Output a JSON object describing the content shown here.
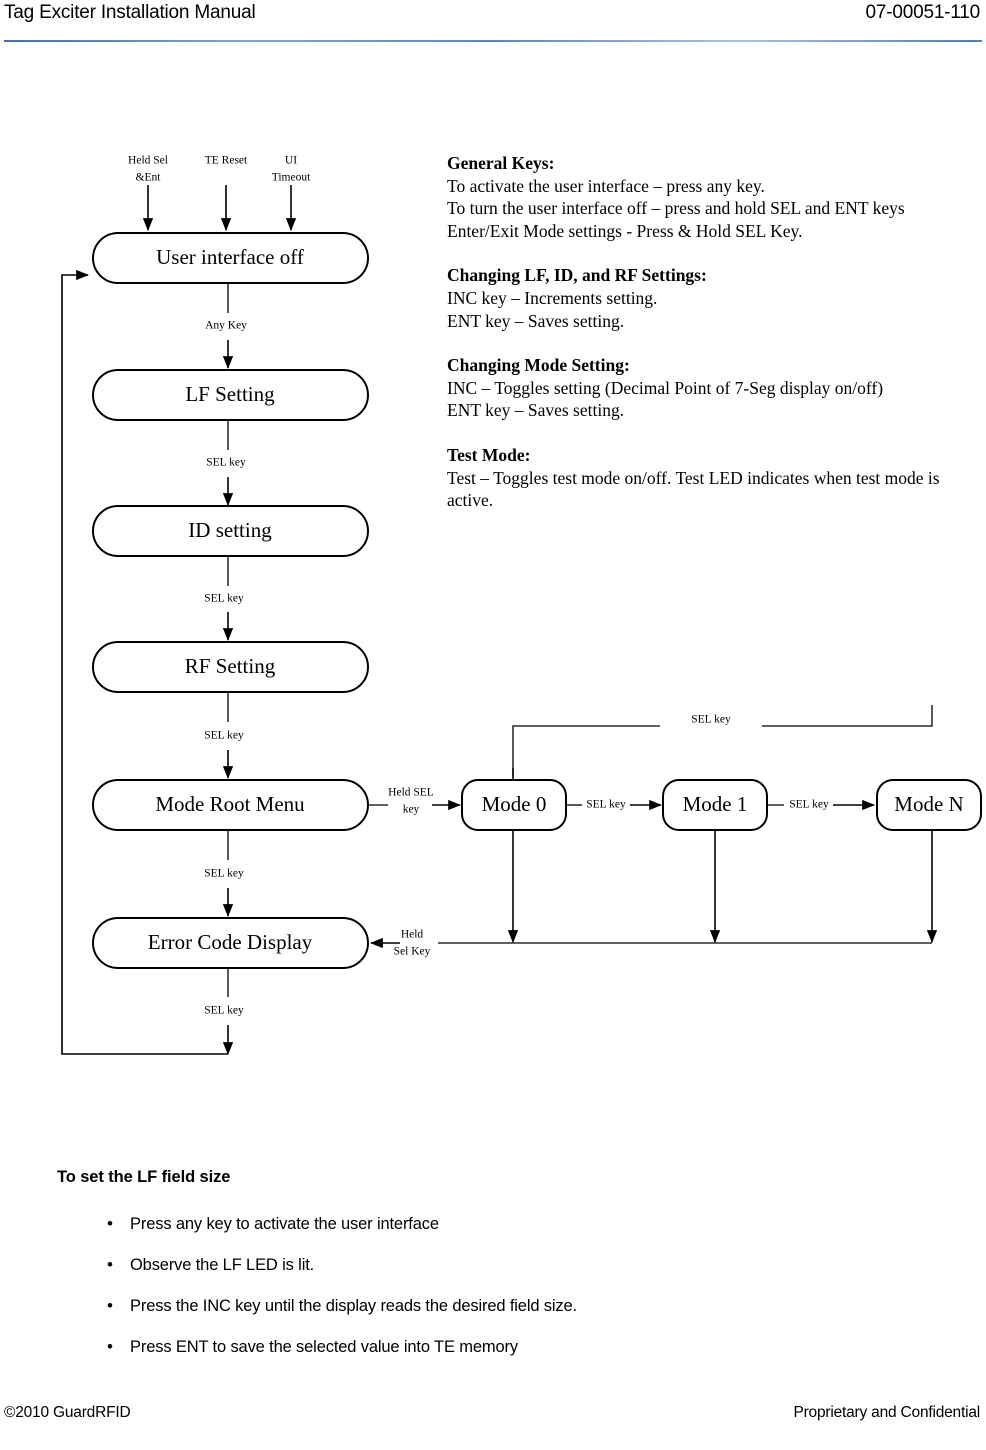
{
  "header": {
    "title": "Tag Exciter Installation Manual",
    "doc_number": "07-00051-110"
  },
  "diagram": {
    "inputs": [
      {
        "label_line1": "Held Sel",
        "label_line2": "&Ent"
      },
      {
        "label_line1": "TE Reset",
        "label_line2": ""
      },
      {
        "label_line1": "UI",
        "label_line2": "Timeout"
      }
    ],
    "main_nodes": [
      {
        "label": "User interface off"
      },
      {
        "label": "LF Setting"
      },
      {
        "label": "ID setting"
      },
      {
        "label": "RF Setting"
      },
      {
        "label": "Mode Root Menu"
      },
      {
        "label": "Error Code Display"
      }
    ],
    "main_edges": [
      {
        "label": "Any Key"
      },
      {
        "label": "SEL key"
      },
      {
        "label": "SEL key"
      },
      {
        "label": "SEL key"
      },
      {
        "label": "SEL key"
      },
      {
        "label": "SEL key"
      }
    ],
    "mode_nodes": [
      {
        "label": "Mode 0"
      },
      {
        "label": "Mode 1"
      },
      {
        "label": "Mode N"
      }
    ],
    "mode_edges": {
      "enter": "Held SEL\nkey",
      "enter_line1": "Held SEL",
      "enter_line2": "key",
      "between_0_1": "SEL key",
      "between_1_n": "SEL key",
      "feedback_top": "SEL key",
      "exit_line1": "Held",
      "exit_line2": "Sel Key"
    }
  },
  "notes": {
    "blocks": [
      {
        "heading": "General Keys:",
        "lines": [
          "To activate the user interface – press any key.",
          "To turn the user interface off – press and hold SEL and ENT keys",
          "Enter/Exit Mode settings - Press & Hold SEL Key."
        ]
      },
      {
        "heading": "Changing LF, ID, and RF Settings:",
        "lines": [
          "INC key – Increments setting.",
          "ENT key – Saves setting."
        ]
      },
      {
        "heading": "Changing Mode Setting:",
        "lines": [
          "INC – Toggles setting (Decimal Point of 7-Seg display on/off)",
          "ENT  key – Saves setting."
        ]
      },
      {
        "heading": "Test Mode:",
        "lines": [
          "Test – Toggles test mode on/off. Test LED indicates when test mode is active."
        ]
      }
    ]
  },
  "lf_section": {
    "heading": "To set the LF field size",
    "bullets": [
      "Press any key to activate the user interface",
      "Observe the LF LED is lit.",
      "Press the INC key until the display reads the desired field size.",
      "Press ENT to save the selected value into TE memory"
    ]
  },
  "footer": {
    "left": "©2010 GuardRFID",
    "right": "Proprietary and Confidential"
  },
  "colors": {
    "rule_accent": "#4472a8",
    "ink": "#000000",
    "page": "#ffffff"
  }
}
